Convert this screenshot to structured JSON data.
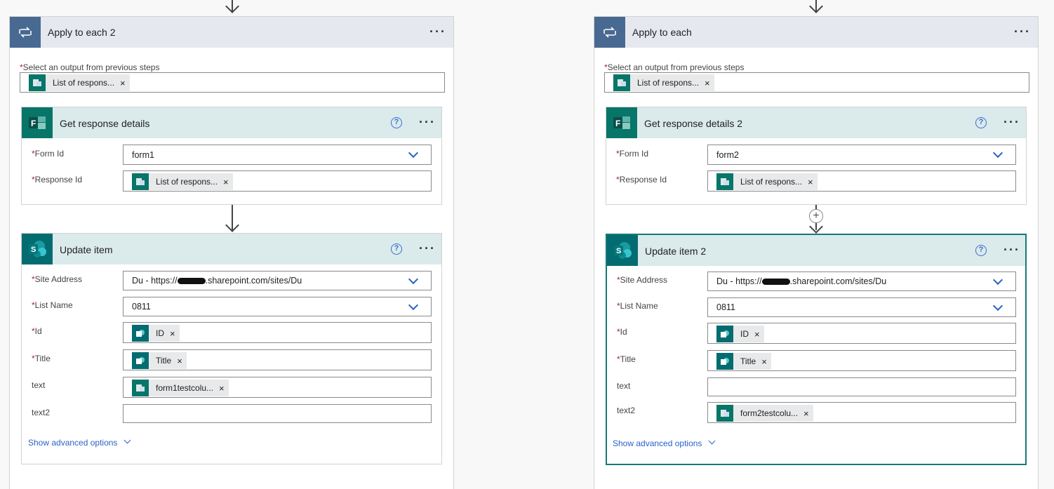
{
  "left": {
    "apply": {
      "title": "Apply to each 2",
      "select_label": "Select an output from previous steps",
      "token": "List of respons..."
    },
    "get_details": {
      "title": "Get response details",
      "form_id_label": "Form Id",
      "form_id_value": "form1",
      "response_id_label": "Response Id",
      "response_token": "List of respons..."
    },
    "update": {
      "title": "Update item",
      "site_label": "Site Address",
      "site_prefix": "Du - https://",
      "site_suffix": ".sharepoint.com/sites/Du",
      "list_label": "List Name",
      "list_value": "0811",
      "id_label": "Id",
      "id_token": "ID",
      "title_label": "Title",
      "title_token": "Title",
      "text_label": "text",
      "text_token": "form1testcolu...",
      "text2_label": "text2",
      "advanced": "Show advanced options"
    }
  },
  "right": {
    "apply": {
      "title": "Apply to each",
      "select_label": "Select an output from previous steps",
      "token": "List of respons..."
    },
    "get_details": {
      "title": "Get response details 2",
      "form_id_label": "Form Id",
      "form_id_value": "form2",
      "response_id_label": "Response Id",
      "response_token": "List of respons..."
    },
    "update": {
      "title": "Update item 2",
      "site_label": "Site Address",
      "site_prefix": "Du - https://",
      "site_suffix": ".sharepoint.com/sites/Du",
      "list_label": "List Name",
      "list_value": "0811",
      "id_label": "Id",
      "id_token": "ID",
      "title_label": "Title",
      "title_token": "Title",
      "text_label": "text",
      "text2_label": "text2",
      "text2_token": "form2testcolu...",
      "advanced": "Show advanced options"
    }
  },
  "common": {
    "required_mark": "*",
    "more_dots": "···",
    "help": "?",
    "remove": "×",
    "add": "+"
  }
}
